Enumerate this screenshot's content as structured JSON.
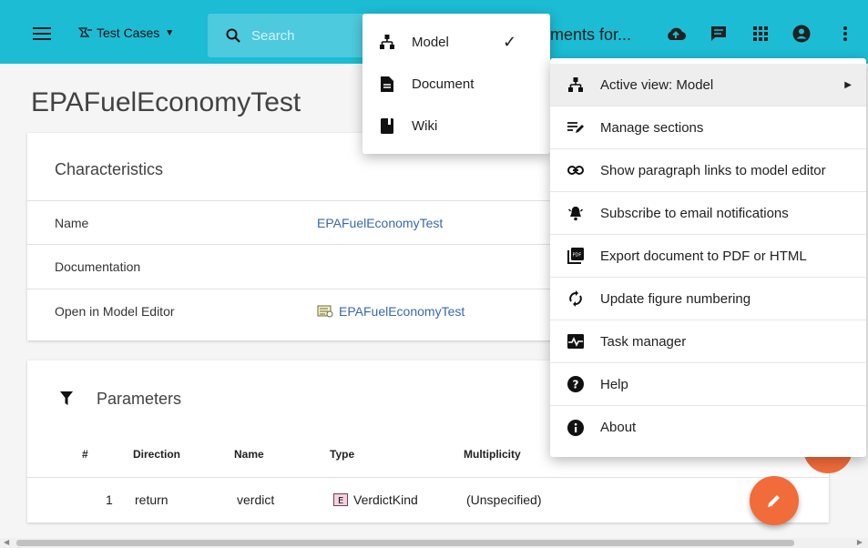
{
  "header": {
    "test_cases_label": "Test Cases",
    "search_placeholder": "Search",
    "doc_title": "ments for..."
  },
  "page": {
    "title": "EPAFuelEconomyTest"
  },
  "characteristics": {
    "title": "Characteristics",
    "rows": [
      {
        "label": "Name",
        "value": "EPAFuelEconomyTest"
      },
      {
        "label": "Documentation",
        "value": ""
      },
      {
        "label": "Open in Model Editor",
        "value": "EPAFuelEconomyTest"
      }
    ]
  },
  "parameters": {
    "title": "Parameters",
    "columns": [
      "#",
      "Direction",
      "Name",
      "Type",
      "Multiplicity"
    ],
    "rows": [
      {
        "num": "1",
        "direction": "return",
        "name": "verdict",
        "type": "VerdictKind",
        "multiplicity": "(Unspecified)"
      }
    ]
  },
  "view_menu": {
    "items": [
      {
        "label": "Model",
        "icon": "sitemap-icon",
        "checked": "✓"
      },
      {
        "label": "Document",
        "icon": "document-icon"
      },
      {
        "label": "Wiki",
        "icon": "book-icon"
      }
    ]
  },
  "more_menu": {
    "items": [
      {
        "label": "Active view: Model",
        "icon": "sitemap-icon"
      },
      {
        "label": "Manage sections",
        "icon": "playlist-edit-icon"
      },
      {
        "label": "Show paragraph links to model editor",
        "icon": "link-icon"
      },
      {
        "label": "Subscribe to email notifications",
        "icon": "bell-ring-icon"
      },
      {
        "label": "Export document to PDF or HTML",
        "icon": "pdf-icon"
      },
      {
        "label": "Update figure numbering",
        "icon": "refresh-icon"
      },
      {
        "label": "Task manager",
        "icon": "pulse-monitor-icon"
      },
      {
        "label": "Help",
        "icon": "help-circle-icon"
      },
      {
        "label": "About",
        "icon": "info-icon"
      }
    ]
  },
  "colors": {
    "topbar": "#1cbcd4",
    "link": "#3a67b0",
    "fab": "#f26b3a"
  }
}
